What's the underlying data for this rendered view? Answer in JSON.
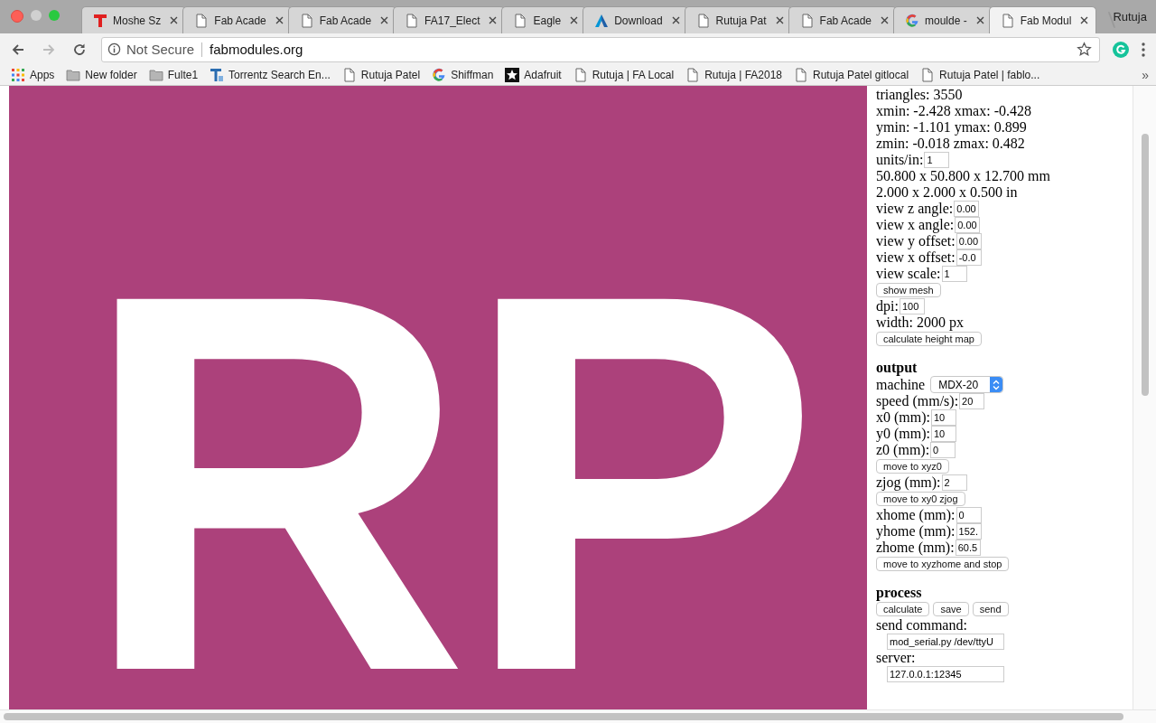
{
  "browser": {
    "tabs": [
      {
        "title": "Moshe Sz",
        "kind": "t-logo",
        "selected": false
      },
      {
        "title": "Fab Acade",
        "kind": "doc",
        "selected": false
      },
      {
        "title": "Fab Acade",
        "kind": "doc",
        "selected": false
      },
      {
        "title": "FA17_Elect",
        "kind": "doc",
        "selected": false
      },
      {
        "title": "Eagle",
        "kind": "doc",
        "selected": false
      },
      {
        "title": "Download",
        "kind": "a-logo",
        "selected": false
      },
      {
        "title": "Rutuja Pat",
        "kind": "doc",
        "selected": false
      },
      {
        "title": "Fab Acade",
        "kind": "doc",
        "selected": false
      },
      {
        "title": "moulde -",
        "kind": "g-logo",
        "selected": false
      },
      {
        "title": "Fab Modul",
        "kind": "doc",
        "selected": true
      }
    ],
    "profile": "Rutuja",
    "address": {
      "security": "Not Secure",
      "url": "fabmodules.org"
    },
    "bookmarks": [
      {
        "label": "Apps",
        "kind": "apps"
      },
      {
        "label": "New folder",
        "kind": "folder"
      },
      {
        "label": "Fulte1",
        "kind": "folder"
      },
      {
        "label": "Torrentz Search En...",
        "kind": "t2-logo"
      },
      {
        "label": "Rutuja Patel",
        "kind": "doc"
      },
      {
        "label": "Shiffman",
        "kind": "g-logo"
      },
      {
        "label": "Adafruit",
        "kind": "star-logo"
      },
      {
        "label": "Rutuja | FA Local",
        "kind": "doc"
      },
      {
        "label": "Rutuja | FA2018",
        "kind": "doc"
      },
      {
        "label": "Rutuja Patel gitlocal",
        "kind": "doc"
      },
      {
        "label": "Rutuja Patel | fablo...",
        "kind": "doc"
      }
    ],
    "bookmarks_more": "»"
  },
  "preview": {
    "text": "RP"
  },
  "panel": {
    "rows": [
      {
        "kind": "text",
        "text": "triangles: 3550"
      },
      {
        "kind": "text",
        "text": "xmin: -2.428 xmax: -0.428"
      },
      {
        "kind": "text",
        "text": "ymin: -1.101 ymax: 0.899"
      },
      {
        "kind": "text",
        "text": "zmin: -0.018 zmax: 0.482"
      },
      {
        "kind": "field",
        "label": "units/in:",
        "value": "1"
      },
      {
        "kind": "text",
        "text": "50.800 x 50.800 x 12.700 mm"
      },
      {
        "kind": "text",
        "text": "2.000 x 2.000 x 0.500 in"
      },
      {
        "kind": "field",
        "label": "view z angle:",
        "value": "0.00"
      },
      {
        "kind": "field",
        "label": "view x angle:",
        "value": "0.00"
      },
      {
        "kind": "field",
        "label": "view y offset:",
        "value": "0.00"
      },
      {
        "kind": "field",
        "label": "view x offset:",
        "value": "-0.0"
      },
      {
        "kind": "field",
        "label": "view scale:",
        "value": "1"
      },
      {
        "kind": "button",
        "label": "show mesh"
      },
      {
        "kind": "field",
        "label": "dpi:",
        "value": "100"
      },
      {
        "kind": "text",
        "text": "width: 2000 px"
      },
      {
        "kind": "button",
        "label": "calculate height map"
      },
      {
        "kind": "heading",
        "text": "output"
      },
      {
        "kind": "select",
        "label": "machine",
        "value": "MDX-20"
      },
      {
        "kind": "field",
        "label": "speed (mm/s):",
        "value": "20"
      },
      {
        "kind": "field",
        "label": "x0 (mm):",
        "value": "10"
      },
      {
        "kind": "field",
        "label": "y0 (mm):",
        "value": "10"
      },
      {
        "kind": "field",
        "label": "z0 (mm):",
        "value": "0"
      },
      {
        "kind": "button",
        "label": "move to xyz0"
      },
      {
        "kind": "field",
        "label": "zjog (mm):",
        "value": "2"
      },
      {
        "kind": "button",
        "label": "move to xy0 zjog"
      },
      {
        "kind": "field",
        "label": "xhome (mm):",
        "value": "0"
      },
      {
        "kind": "field",
        "label": "yhome (mm):",
        "value": "152."
      },
      {
        "kind": "field",
        "label": "zhome (mm):",
        "value": "60.5"
      },
      {
        "kind": "button",
        "label": "move to xyzhome and stop"
      },
      {
        "kind": "heading",
        "text": "process"
      },
      {
        "kind": "buttons",
        "buttons": [
          "calculate",
          "save",
          "send"
        ]
      },
      {
        "kind": "block_field",
        "label": "send command:",
        "value": "mod_serial.py /dev/ttyU"
      },
      {
        "kind": "block_field",
        "label": "server:",
        "value": "127.0.0.1:12345"
      }
    ]
  }
}
